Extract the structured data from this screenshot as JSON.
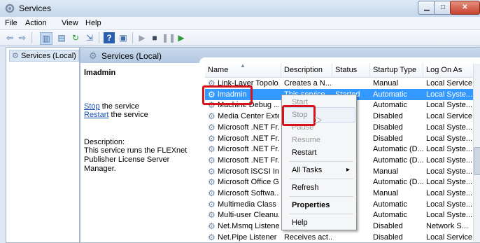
{
  "window": {
    "title": "Services"
  },
  "menu": [
    "File",
    "Action",
    "View",
    "Help"
  ],
  "toolbar_icons": [
    "back-icon",
    "forward-icon",
    "show-tree-icon",
    "properties-icon",
    "refresh-icon",
    "export-icon",
    "help-icon",
    "help-topic-icon",
    "start-icon",
    "stop-icon",
    "pause-icon",
    "restart-icon"
  ],
  "tree": {
    "root_label": "Services (Local)"
  },
  "main": {
    "header_title": "Services (Local)"
  },
  "description_pane": {
    "service_name": "lmadmin",
    "stop_link": "Stop",
    "stop_suffix": " the service",
    "restart_link": "Restart",
    "restart_suffix": " the service",
    "description_label": "Description:",
    "description_text": "This service runs the FLEXnet Publisher License Server Manager."
  },
  "columns": [
    "Name",
    "Description",
    "Status",
    "Startup Type",
    "Log On As"
  ],
  "rows": [
    {
      "name": "Link-Layer Topolo...",
      "description": "Creates a N...",
      "status": "",
      "startup": "Manual",
      "logon": "Local Service"
    },
    {
      "name": "lmadmin",
      "description": "This service...",
      "status": "Started",
      "startup": "Automatic",
      "logon": "Local Syste..."
    },
    {
      "name": "Machine Debug ...",
      "description": "",
      "status": "",
      "startup": "Automatic",
      "logon": "Local Syste..."
    },
    {
      "name": "Media Center Exte...",
      "description": "",
      "status": "",
      "startup": "Disabled",
      "logon": "Local Service"
    },
    {
      "name": "Microsoft .NET Fr...",
      "description": "",
      "status": "",
      "startup": "Disabled",
      "logon": "Local Syste..."
    },
    {
      "name": "Microsoft .NET Fr...",
      "description": "",
      "status": "",
      "startup": "Disabled",
      "logon": "Local Syste..."
    },
    {
      "name": "Microsoft .NET Fr...",
      "description": "",
      "status": "",
      "startup": "Automatic (D...",
      "logon": "Local Syste..."
    },
    {
      "name": "Microsoft .NET Fr...",
      "description": "",
      "status": "",
      "startup": "Automatic (D...",
      "logon": "Local Syste..."
    },
    {
      "name": "Microsoft iSCSI In...",
      "description": "",
      "status": "",
      "startup": "Manual",
      "logon": "Local Syste..."
    },
    {
      "name": "Microsoft Office G...",
      "description": "",
      "status": "",
      "startup": "Automatic (D...",
      "logon": "Local Syste..."
    },
    {
      "name": "Microsoft Softwa...",
      "description": "",
      "status": "",
      "startup": "Manual",
      "logon": "Local Syste..."
    },
    {
      "name": "Multimedia Class ...",
      "description": "",
      "status": "",
      "startup": "Automatic",
      "logon": "Local Syste..."
    },
    {
      "name": "Multi-user Cleanu...",
      "description": "",
      "status": "",
      "startup": "Automatic",
      "logon": "Local Syste..."
    },
    {
      "name": "Net.Msmq Listene...",
      "description": "",
      "status": "",
      "startup": "Disabled",
      "logon": "Network S..."
    },
    {
      "name": "Net.Pipe Listener ...",
      "description": "Receives act...",
      "status": "",
      "startup": "Disabled",
      "logon": "Local Service"
    }
  ],
  "context_menu": {
    "items": [
      {
        "label": "Start",
        "disabled": true
      },
      {
        "label": "Stop",
        "disabled": false
      },
      {
        "label": "Pause",
        "disabled": true
      },
      {
        "label": "Resume",
        "disabled": true
      },
      {
        "label": "Restart",
        "disabled": false
      },
      {
        "label": "All Tasks",
        "disabled": false
      },
      {
        "label": "Refresh",
        "disabled": false
      },
      {
        "label": "Properties",
        "disabled": false
      },
      {
        "label": "Help",
        "disabled": false
      }
    ],
    "submenu_arrow": "▸"
  },
  "colors": {
    "selection": "#3399ff",
    "highlight_box": "#d8121a",
    "link": "#1a55b0"
  }
}
